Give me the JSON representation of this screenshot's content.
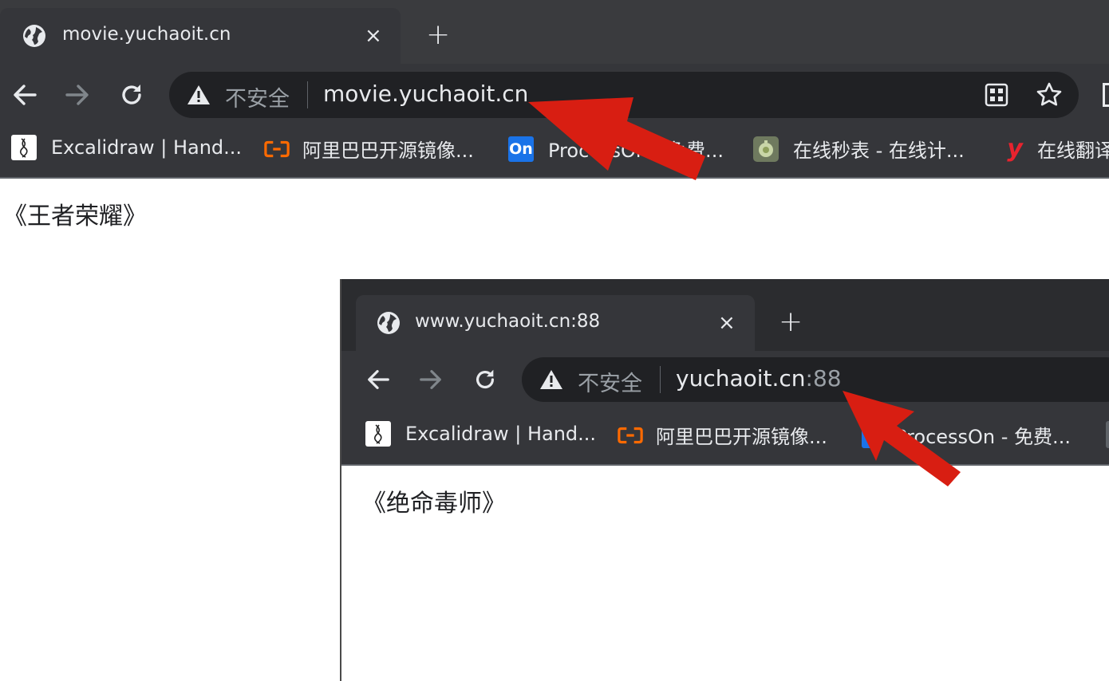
{
  "browser_main": {
    "tab": {
      "title": "movie.yuchaoit.cn",
      "close": "×"
    },
    "new_tab": "+",
    "omnibox": {
      "security_label": "不安全",
      "url": "movie.yuchaoit.cn"
    },
    "bookmarks": [
      {
        "label": "Excalidraw | Hand...",
        "icon": "excalidraw-icon"
      },
      {
        "label": "阿里巴巴开源镜像...",
        "icon": "aliyun-icon"
      },
      {
        "label": "ProcessOn - 免费...",
        "icon": "processon-icon",
        "icon_text": "On"
      },
      {
        "label": "在线秒表 - 在线计...",
        "icon": "stopwatch-icon"
      },
      {
        "label": "在线翻译",
        "icon": "youdao-icon",
        "icon_text": "y"
      }
    ],
    "page_text": "《王者荣耀》"
  },
  "browser_inner": {
    "tab": {
      "title": "www.yuchaoit.cn:88",
      "close": "×"
    },
    "new_tab": "+",
    "omnibox": {
      "security_label": "不安全",
      "url_host": "yuchaoit.cn",
      "url_port": ":88"
    },
    "bookmarks": [
      {
        "label": "Excalidraw | Hand...",
        "icon": "excalidraw-icon"
      },
      {
        "label": "阿里巴巴开源镜像...",
        "icon": "aliyun-icon"
      },
      {
        "label": "ProcessOn - 免费...",
        "icon": "processon-icon"
      }
    ],
    "page_text": "《绝命毒师》"
  },
  "colors": {
    "tabstrip": "#3a3b3e",
    "toolbar": "#35363a",
    "omnibox": "#202124",
    "annotation_arrow": "#d81e12"
  }
}
